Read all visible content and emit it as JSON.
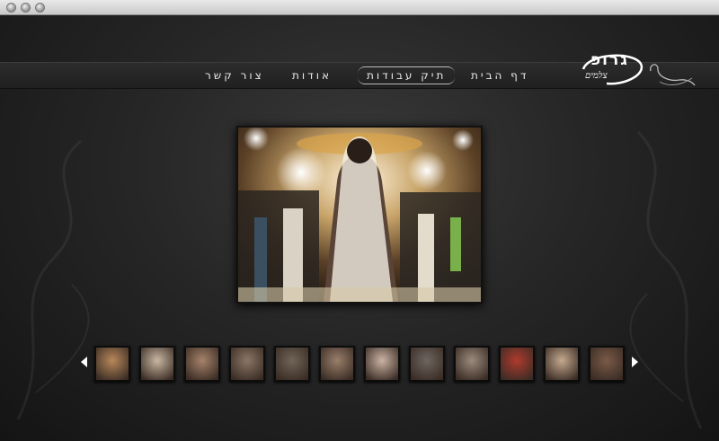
{
  "nav": {
    "home": "דף הבית",
    "portfolio": "תיק עבודות",
    "about": "אודות",
    "contact": "צור קשר"
  },
  "logo": {
    "main": "גרופ",
    "sub": "צלמים"
  },
  "thumbnails": [
    {
      "color": "#b8885a"
    },
    {
      "color": "#c9b7a2"
    },
    {
      "color": "#a6836b"
    },
    {
      "color": "#8a7664"
    },
    {
      "color": "#706457"
    },
    {
      "color": "#9a7f6a"
    },
    {
      "color": "#cbb3a4"
    },
    {
      "color": "#6e6560"
    },
    {
      "color": "#9b8a7d"
    },
    {
      "color": "#b03a2e"
    },
    {
      "color": "#c5a98f"
    },
    {
      "color": "#7a5a48"
    }
  ],
  "colors": {
    "background": "#262626",
    "navbar": "#232323",
    "text": "#e8e8e8"
  }
}
